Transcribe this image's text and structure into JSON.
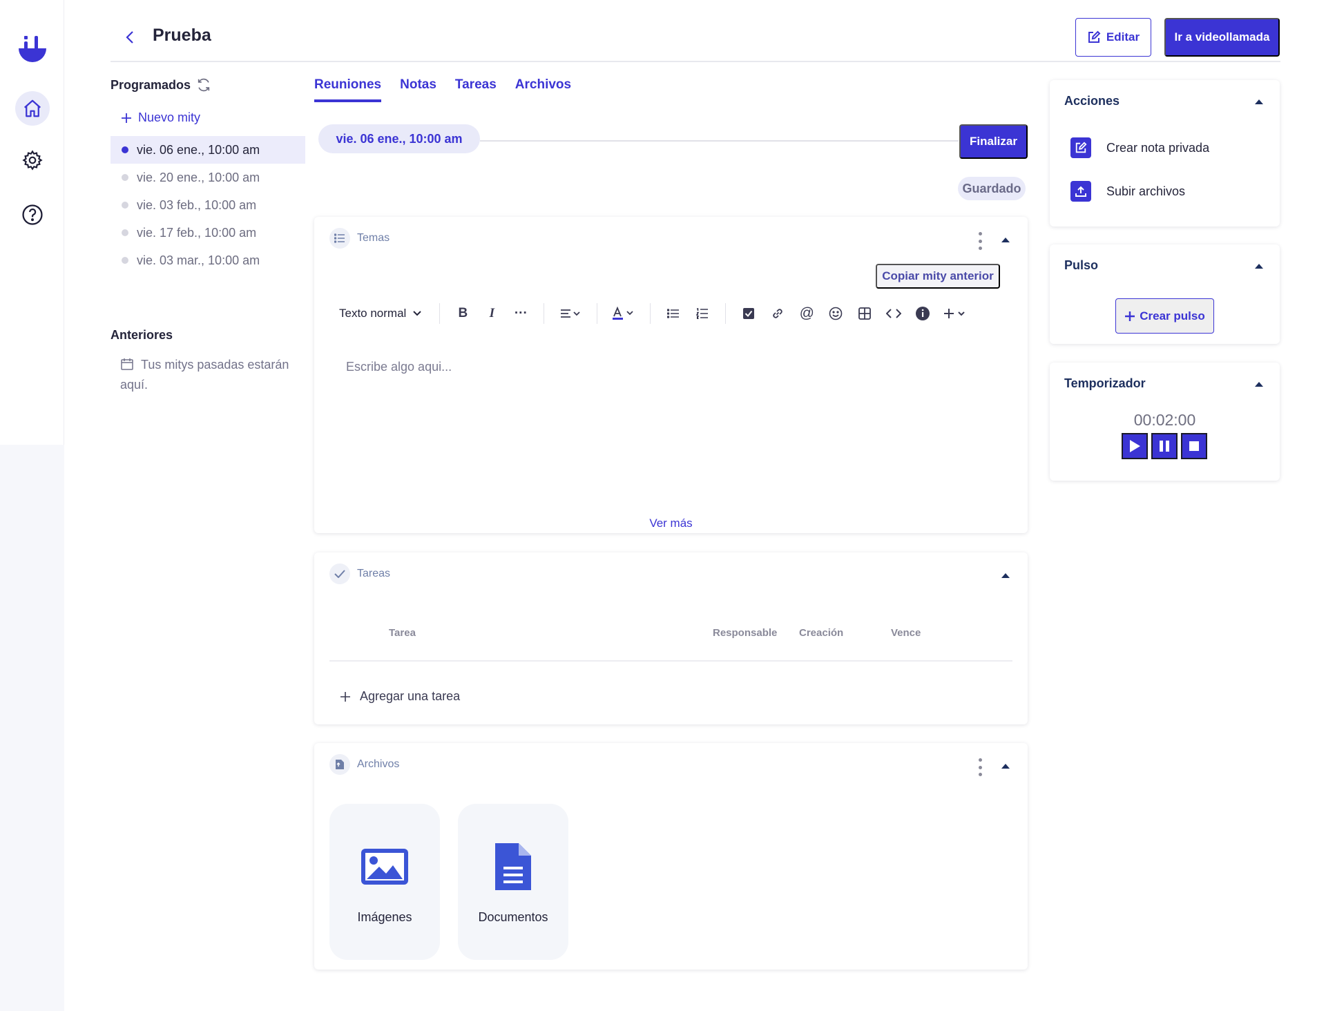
{
  "header": {
    "title": "Prueba",
    "edit_label": "Editar",
    "video_label": "Ir a videollamada"
  },
  "left": {
    "scheduled_title": "Programados",
    "new_mity": "Nuevo mity",
    "dates": [
      "vie. 06 ene., 10:00 am",
      "vie. 20 ene., 10:00 am",
      "vie. 03 feb., 10:00 am",
      "vie. 17 feb., 10:00 am",
      "vie. 03 mar., 10:00 am"
    ],
    "previous_title": "Anteriores",
    "previous_empty": "Tus mitys pasadas estarán aquí."
  },
  "tabs": [
    "Reuniones",
    "Notas",
    "Tareas",
    "Archivos"
  ],
  "meeting": {
    "current_date": "vie. 06 ene., 10:00 am",
    "finish_label": "Finalizar",
    "saved_label": "Guardado"
  },
  "topics": {
    "title": "Temas",
    "copy_label": "Copiar mity anterior",
    "text_style": "Texto normal",
    "placeholder": "Escribe algo aqui...",
    "see_more": "Ver más"
  },
  "tasks": {
    "title": "Tareas",
    "columns": [
      "Tarea",
      "Responsable",
      "Creación",
      "Vence"
    ],
    "add_label": "Agregar una tarea"
  },
  "files": {
    "title": "Archivos",
    "tiles": [
      "Imágenes",
      "Documentos"
    ]
  },
  "sidebar": {
    "actions_title": "Acciones",
    "actions": [
      "Crear nota privada",
      "Subir archivos"
    ],
    "pulse_title": "Pulso",
    "pulse_button": "Crear pulso",
    "timer_title": "Temporizador",
    "timer_value": "00:02:00"
  },
  "colors": {
    "accent": "#3b34d4",
    "muted": "#6f7fa8"
  },
  "icons": [
    "logo-icon",
    "home-icon",
    "gear-icon",
    "help-icon",
    "chevron-left-icon",
    "edit-icon",
    "refresh-icon",
    "plus-icon",
    "calendar-icon",
    "list-icon",
    "check-icon",
    "file-icon",
    "image-icon",
    "document-icon",
    "upload-icon",
    "play-icon",
    "pause-icon",
    "stop-icon"
  ]
}
